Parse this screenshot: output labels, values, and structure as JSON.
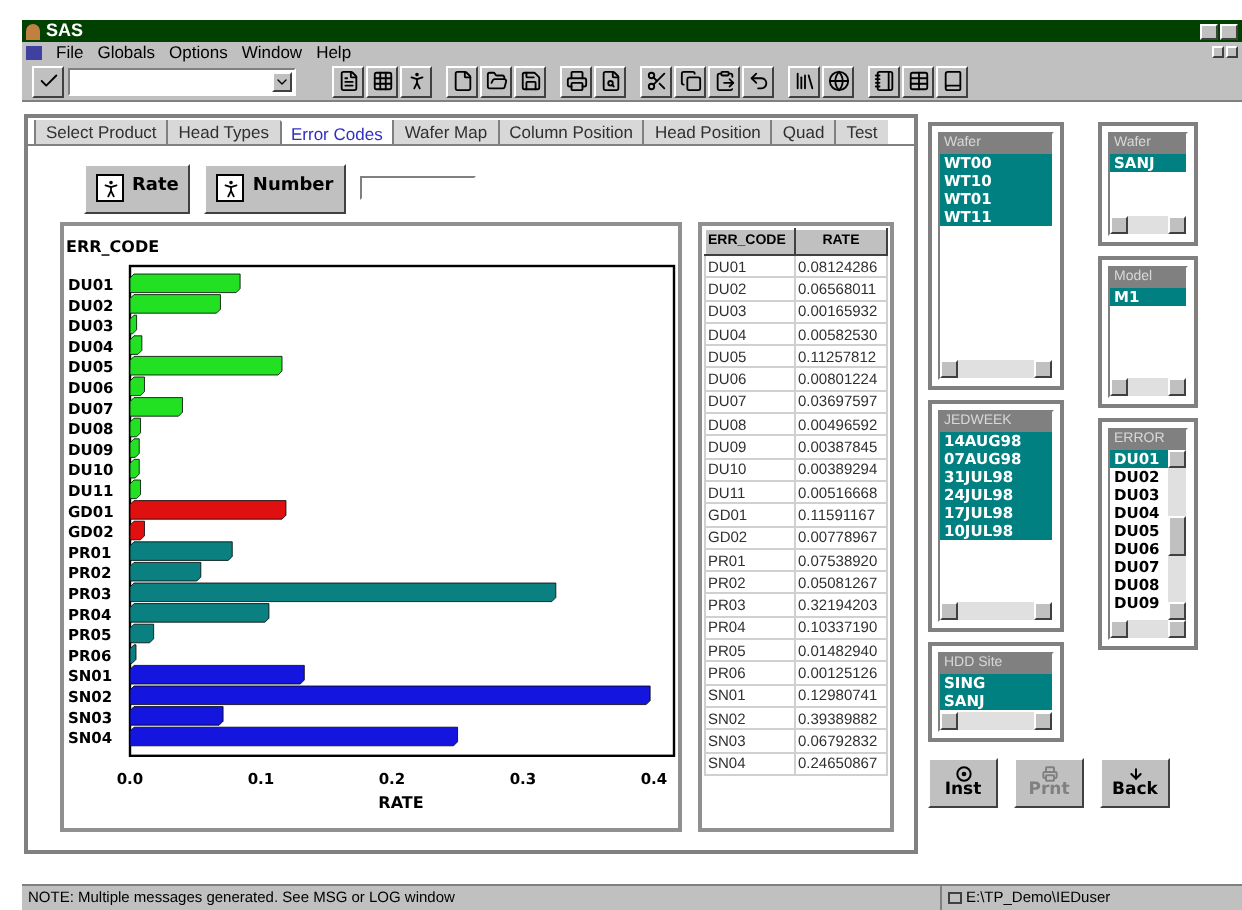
{
  "window": {
    "title": "SAS"
  },
  "menu": [
    "File",
    "Globals",
    "Options",
    "Window",
    "Help"
  ],
  "tabs": [
    {
      "label": "Select Product",
      "selected": false
    },
    {
      "label": "Head Types",
      "selected": false
    },
    {
      "label": "Error Codes",
      "selected": true
    },
    {
      "label": "Wafer Map",
      "selected": false
    },
    {
      "label": "Column Position",
      "selected": false
    },
    {
      "label": "Head Position",
      "selected": false
    },
    {
      "label": "Quad",
      "selected": false
    },
    {
      "label": "Test",
      "selected": false
    }
  ],
  "actions": [
    {
      "label": "Rate"
    },
    {
      "label": "Number"
    }
  ],
  "chart": {
    "chart_data": {
      "type": "bar",
      "orientation": "horizontal",
      "ylabel": "ERR_CODE",
      "xlabel": "RATE",
      "categories": [
        "DU01",
        "DU02",
        "DU03",
        "DU04",
        "DU05",
        "DU06",
        "DU07",
        "DU08",
        "DU09",
        "DU10",
        "DU11",
        "GD01",
        "GD02",
        "PR01",
        "PR02",
        "PR03",
        "PR04",
        "PR05",
        "PR06",
        "SN01",
        "SN02",
        "SN03",
        "SN04"
      ],
      "series": [
        {
          "color": "#22e022",
          "values": [
            0.081,
            0.066,
            0.002,
            0.006,
            0.113,
            0.008,
            0.037,
            0.005,
            0.004,
            0.004,
            0.005,
            null,
            null,
            null,
            null,
            null,
            null,
            null,
            null,
            null,
            null,
            null,
            null
          ]
        },
        {
          "color": "#e01010",
          "values": [
            null,
            null,
            null,
            null,
            null,
            null,
            null,
            null,
            null,
            null,
            null,
            0.116,
            0.008,
            null,
            null,
            null,
            null,
            null,
            null,
            null,
            null,
            null,
            null
          ]
        },
        {
          "color": "#0a8080",
          "values": [
            null,
            null,
            null,
            null,
            null,
            null,
            null,
            null,
            null,
            null,
            null,
            null,
            null,
            0.075,
            0.051,
            0.322,
            0.103,
            0.015,
            0.001,
            null,
            null,
            null,
            null
          ]
        },
        {
          "color": "#1515e0",
          "values": [
            null,
            null,
            null,
            null,
            null,
            null,
            null,
            null,
            null,
            null,
            null,
            null,
            null,
            null,
            null,
            null,
            null,
            null,
            null,
            0.13,
            0.394,
            0.068,
            0.247
          ]
        }
      ],
      "xlim": [
        0,
        0.4
      ],
      "xticks": [
        {
          "value": 0,
          "label": "0.0"
        },
        {
          "value": 0.1,
          "label": "0.1"
        },
        {
          "value": 0.2,
          "label": "0.2"
        },
        {
          "value": 0.3,
          "label": "0.3"
        },
        {
          "value": 0.4,
          "label": "0.4"
        }
      ]
    }
  },
  "table": {
    "columns": [
      "ERR_CODE",
      "RATE"
    ],
    "rows": [
      [
        "DU01",
        "0.08124286"
      ],
      [
        "DU02",
        "0.06568011"
      ],
      [
        "DU03",
        "0.00165932"
      ],
      [
        "DU04",
        "0.00582530"
      ],
      [
        "DU05",
        "0.11257812"
      ],
      [
        "DU06",
        "0.00801224"
      ],
      [
        "DU07",
        "0.03697597"
      ],
      [
        "DU08",
        "0.00496592"
      ],
      [
        "DU09",
        "0.00387845"
      ],
      [
        "DU10",
        "0.00389294"
      ],
      [
        "DU11",
        "0.00516668"
      ],
      [
        "GD01",
        "0.11591167"
      ],
      [
        "GD02",
        "0.00778967"
      ],
      [
        "PR01",
        "0.07538920"
      ],
      [
        "PR02",
        "0.05081267"
      ],
      [
        "PR03",
        "0.32194203"
      ],
      [
        "PR04",
        "0.10337190"
      ],
      [
        "PR05",
        "0.01482940"
      ],
      [
        "PR06",
        "0.00125126"
      ],
      [
        "SN01",
        "0.12980741"
      ],
      [
        "SN02",
        "0.39389882"
      ],
      [
        "SN03",
        "0.06792832"
      ],
      [
        "SN04",
        "0.24650867"
      ]
    ]
  },
  "filters": [
    {
      "title": "Wafer",
      "items": [
        {
          "label": "WT00",
          "selected": true
        },
        {
          "label": "WT10",
          "selected": true
        },
        {
          "label": "WT01",
          "selected": true
        },
        {
          "label": "WT11",
          "selected": true
        }
      ]
    },
    {
      "title": "Wafer",
      "items": [
        {
          "label": "SANJ",
          "selected": true
        }
      ]
    },
    {
      "title": "Model",
      "items": [
        {
          "label": "M1",
          "selected": true
        }
      ]
    },
    {
      "title": "JEDWEEK",
      "items": [
        {
          "label": "14AUG98",
          "selected": true
        },
        {
          "label": "07AUG98",
          "selected": true
        },
        {
          "label": "31JUL98",
          "selected": true
        },
        {
          "label": "24JUL98",
          "selected": true
        },
        {
          "label": "17JUL98",
          "selected": true
        },
        {
          "label": "10JUL98",
          "selected": true
        }
      ]
    },
    {
      "title": "ERROR",
      "items": [
        {
          "label": "DU01",
          "selected": true
        },
        {
          "label": "DU02",
          "selected": false
        },
        {
          "label": "DU03",
          "selected": false
        },
        {
          "label": "DU04",
          "selected": false
        },
        {
          "label": "DU05",
          "selected": false
        },
        {
          "label": "DU06",
          "selected": false
        },
        {
          "label": "DU07",
          "selected": false
        },
        {
          "label": "DU08",
          "selected": false
        },
        {
          "label": "DU09",
          "selected": false
        }
      ]
    },
    {
      "title": "HDD Site",
      "items": [
        {
          "label": "SING",
          "selected": true
        },
        {
          "label": "SANJ",
          "selected": true
        }
      ]
    }
  ],
  "buttons": [
    {
      "label": "Inst",
      "disabled": false
    },
    {
      "label": "Prnt",
      "disabled": true
    },
    {
      "label": "Back",
      "disabled": false
    }
  ],
  "status_bar": {
    "message": "NOTE: Multiple messages generated.  See MSG or LOG window",
    "path": "E:\\TP_Demo\\IEDuser"
  }
}
